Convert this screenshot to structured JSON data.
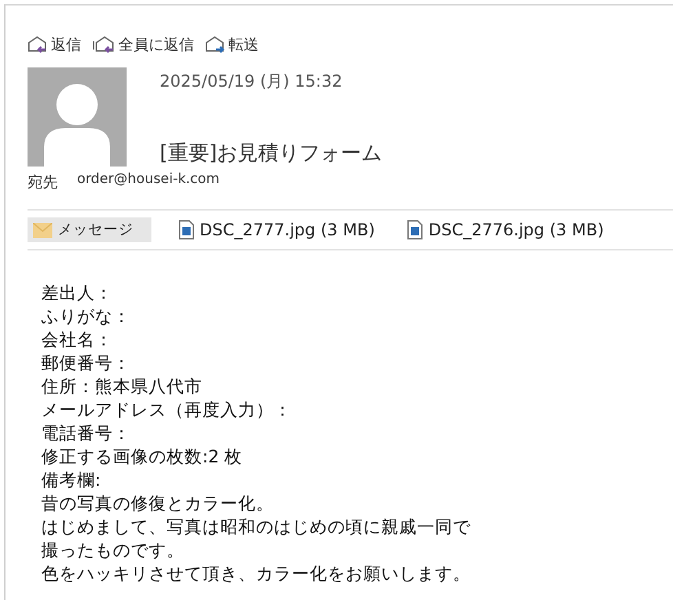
{
  "toolbar": [
    {
      "kind": "reply",
      "label": "返信"
    },
    {
      "kind": "reply-all",
      "label": "全員に返信"
    },
    {
      "kind": "forward",
      "label": "転送"
    }
  ],
  "header": {
    "date": "2025/05/19 (月) 15:32",
    "subject": "[重要]お見積りフォーム",
    "to_label": "宛先",
    "to": "order@housei-k.com"
  },
  "attachments": [
    {
      "kind": "message",
      "label": "メッセージ",
      "selected": true
    },
    {
      "kind": "file",
      "label": "DSC_2777.jpg (3 MB)",
      "selected": false
    },
    {
      "kind": "file",
      "label": "DSC_2776.jpg (3 MB)",
      "selected": false
    }
  ],
  "body": [
    "差出人：",
    "ふりがな：",
    "会社名：",
    "郵便番号：",
    "住所：熊本県八代市",
    "メールアドレス（再度入力）：",
    "電話番号：",
    "修正する画像の枚数:2 枚",
    "備考欄:",
    "昔の写真の修復とカラー化。",
    "はじめまして、写真は昭和のはじめの頃に親戚一同で",
    "撮ったものです。",
    "色をハッキリさせて頂き、カラー化をお願いします。"
  ]
}
